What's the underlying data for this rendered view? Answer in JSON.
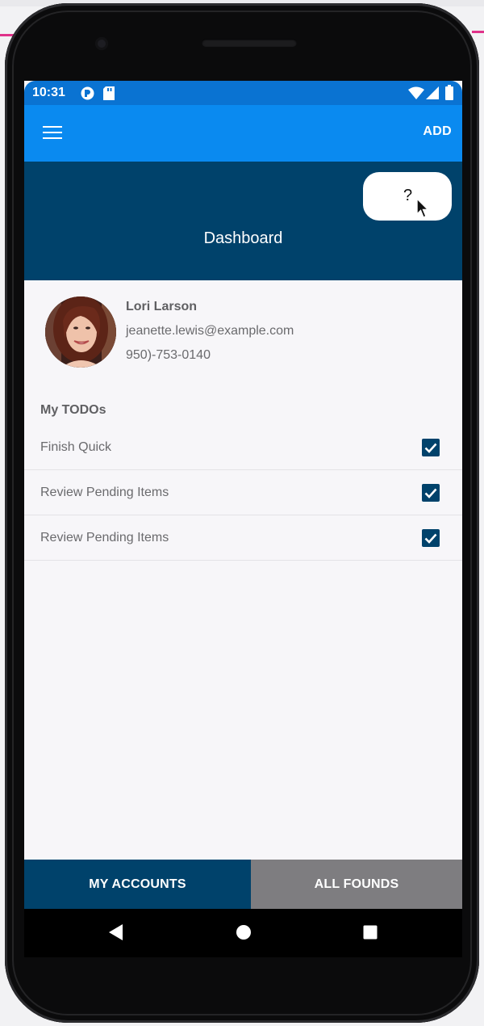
{
  "status_bar": {
    "time": "10:31",
    "background": "#0a73d2"
  },
  "app_bar": {
    "menu_icon": "hamburger-menu-icon",
    "add_label": "ADD",
    "background": "#0a8af0"
  },
  "header": {
    "help_label": "?",
    "title": "Dashboard",
    "background": "#00426b"
  },
  "profile": {
    "name": "Lori Larson",
    "email": "jeanette.lewis@example.com",
    "phone": "950)-753-0140"
  },
  "todos": {
    "title": "My TODOs",
    "items": [
      {
        "label": "Finish Quick",
        "checked": true
      },
      {
        "label": "Review Pending Items",
        "checked": true
      },
      {
        "label": "Review Pending Items",
        "checked": true
      }
    ]
  },
  "tabs": {
    "my_accounts": "MY ACCOUNTS",
    "all_founds": "ALL FOUNDS",
    "active_color": "#00426b",
    "inactive_color": "#7e7d80"
  },
  "nav": {
    "back_icon": "back-triangle-icon",
    "home_icon": "home-circle-icon",
    "recents_icon": "recents-square-icon"
  }
}
